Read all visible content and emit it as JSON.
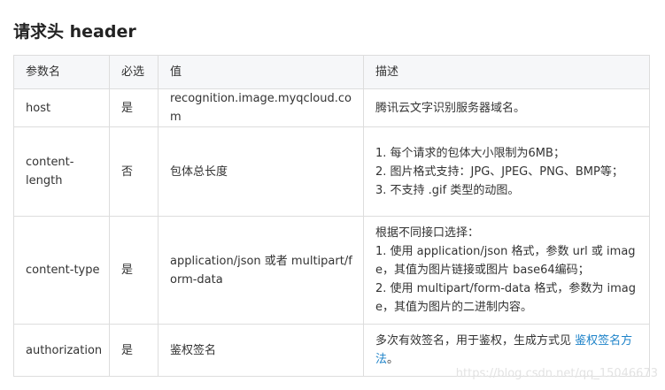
{
  "section": {
    "title": "请求头 header"
  },
  "table": {
    "headers": [
      "参数名",
      "必选",
      "值",
      "描述"
    ],
    "rows": [
      {
        "name": "host",
        "required": "是",
        "value": "recognition.image.myqcloud.com",
        "description": [
          "腾讯云文字识别服务器域名。"
        ]
      },
      {
        "name": "content-length",
        "required": "否",
        "value": "包体总长度",
        "description": [
          "1. 每个请求的包体大小限制为6MB；",
          "2. 图片格式支持：JPG、JPEG、PNG、BMP等；",
          "3. 不支持 .gif 类型的动图。"
        ]
      },
      {
        "name": "content-type",
        "required": "是",
        "value": "application/json 或者 multipart/form-data",
        "description": [
          "根据不同接口选择：",
          "1. 使用 application/json 格式，参数 url 或 image，其值为图片链接或图片 base64编码；",
          "2. 使用 multipart/form-data 格式，参数为 image，其值为图片的二进制内容。"
        ]
      },
      {
        "name": "authorization",
        "required": "是",
        "value": "鉴权签名",
        "description_text": "多次有效签名，用于鉴权，生成方式见",
        "description_link": "鉴权签名方法",
        "description_end": "。"
      }
    ]
  },
  "watermark": "https://blog.csdn.net/qq_15046673"
}
